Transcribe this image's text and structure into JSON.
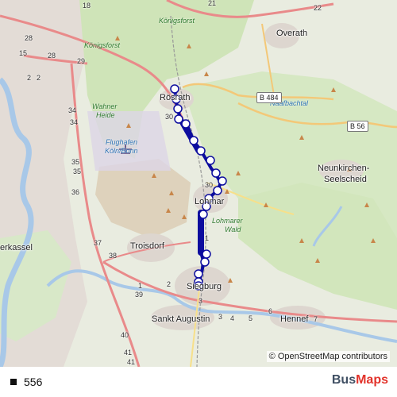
{
  "map": {
    "towns": [
      {
        "name": "Rösrath"
      },
      {
        "name": "Overath"
      },
      {
        "name": "Neunkirchen-"
      },
      {
        "name": "Seelscheid"
      },
      {
        "name": "Lohmar"
      },
      {
        "name": "Troisdorf"
      },
      {
        "name": "Siegburg"
      },
      {
        "name": "Sankt Augustin"
      },
      {
        "name": "Hennef"
      },
      {
        "name": "erkassel"
      }
    ],
    "areas": [
      {
        "name": "Königsforst"
      },
      {
        "name": "Königsforst"
      },
      {
        "name": "Wahner"
      },
      {
        "name": "Heide"
      },
      {
        "name": "Lohmarer"
      },
      {
        "name": "Wald"
      },
      {
        "name": "Flughafen"
      },
      {
        "name": "Köln/Bonn"
      },
      {
        "name": "Naafbachtal"
      }
    ],
    "road_shields": [
      "B 484",
      "B 56"
    ],
    "exit_numbers": [
      "18",
      "21",
      "22",
      "28",
      "15",
      "28",
      "29",
      "2",
      "2",
      "34",
      "34",
      "35",
      "35",
      "36",
      "37",
      "38",
      "30",
      "30",
      "1",
      "2",
      "39",
      "1",
      "3",
      "3",
      "4",
      "5",
      "6",
      "7",
      "40",
      "41",
      "41"
    ],
    "attribution": "© OpenStreetMap contributors",
    "route_color": "#0c0c9e"
  },
  "legend": {
    "route_label": "556",
    "swatch_color": "#111111"
  },
  "brand": {
    "part1": "Bus",
    "part2": "Maps"
  }
}
